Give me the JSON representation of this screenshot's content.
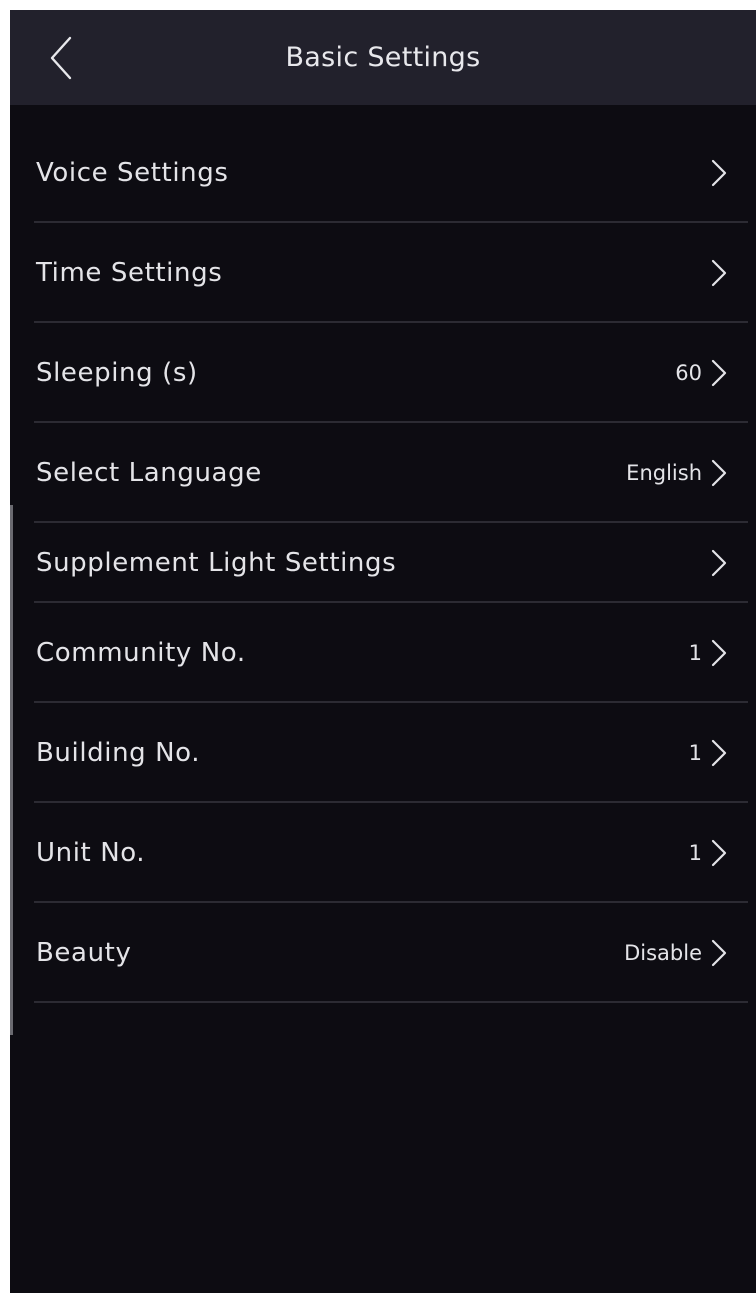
{
  "header": {
    "title": "Basic Settings",
    "back_icon": "chevron-left-icon"
  },
  "settings": [
    {
      "label": "Voice Settings",
      "value": ""
    },
    {
      "label": "Time Settings",
      "value": ""
    },
    {
      "label": "Sleeping (s)",
      "value": "60"
    },
    {
      "label": "Select Language",
      "value": "English"
    },
    {
      "label": "Supplement Light Settings",
      "value": ""
    },
    {
      "label": "Community No.",
      "value": "1"
    },
    {
      "label": "Building No.",
      "value": "1"
    },
    {
      "label": "Unit No.",
      "value": "1"
    },
    {
      "label": "Beauty",
      "value": "Disable"
    }
  ],
  "row_icon": "chevron-right-icon",
  "colors": {
    "background": "#0d0c12",
    "header": "#22212c",
    "text": "#e4e4e8",
    "divider": "#2c2b33"
  }
}
